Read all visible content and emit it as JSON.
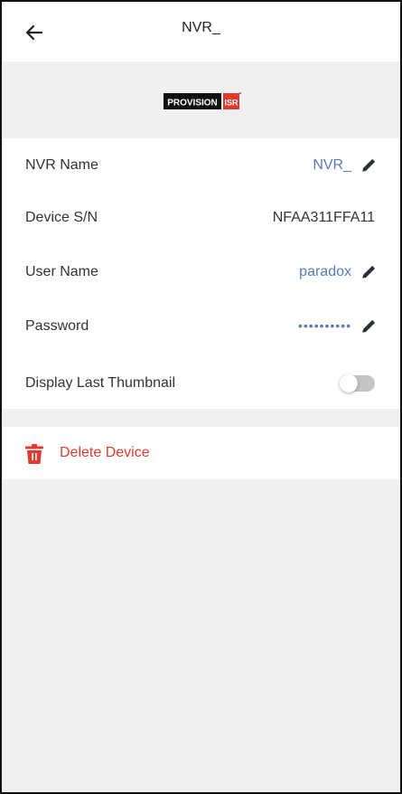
{
  "header": {
    "title": "NVR_"
  },
  "logo": {
    "text_main": "PROVISION",
    "text_badge": "ISR"
  },
  "settings": {
    "nvr_name": {
      "label": "NVR Name",
      "value": "NVR_"
    },
    "serial": {
      "label": "Device S/N",
      "value": "NFAA311FFA11"
    },
    "user": {
      "label": "User Name",
      "value": "paradox"
    },
    "password": {
      "label": "Password",
      "value": "••••••••••"
    },
    "thumbnail": {
      "label": "Display Last Thumbnail",
      "enabled": false
    }
  },
  "delete": {
    "label": "Delete Device"
  },
  "icons": {
    "back": "arrow-left-icon",
    "edit": "pencil-icon",
    "delete": "trash-icon"
  },
  "colors": {
    "accent": "#5a7ab8",
    "danger": "#e03a2f",
    "background": "#f0f0f0"
  }
}
